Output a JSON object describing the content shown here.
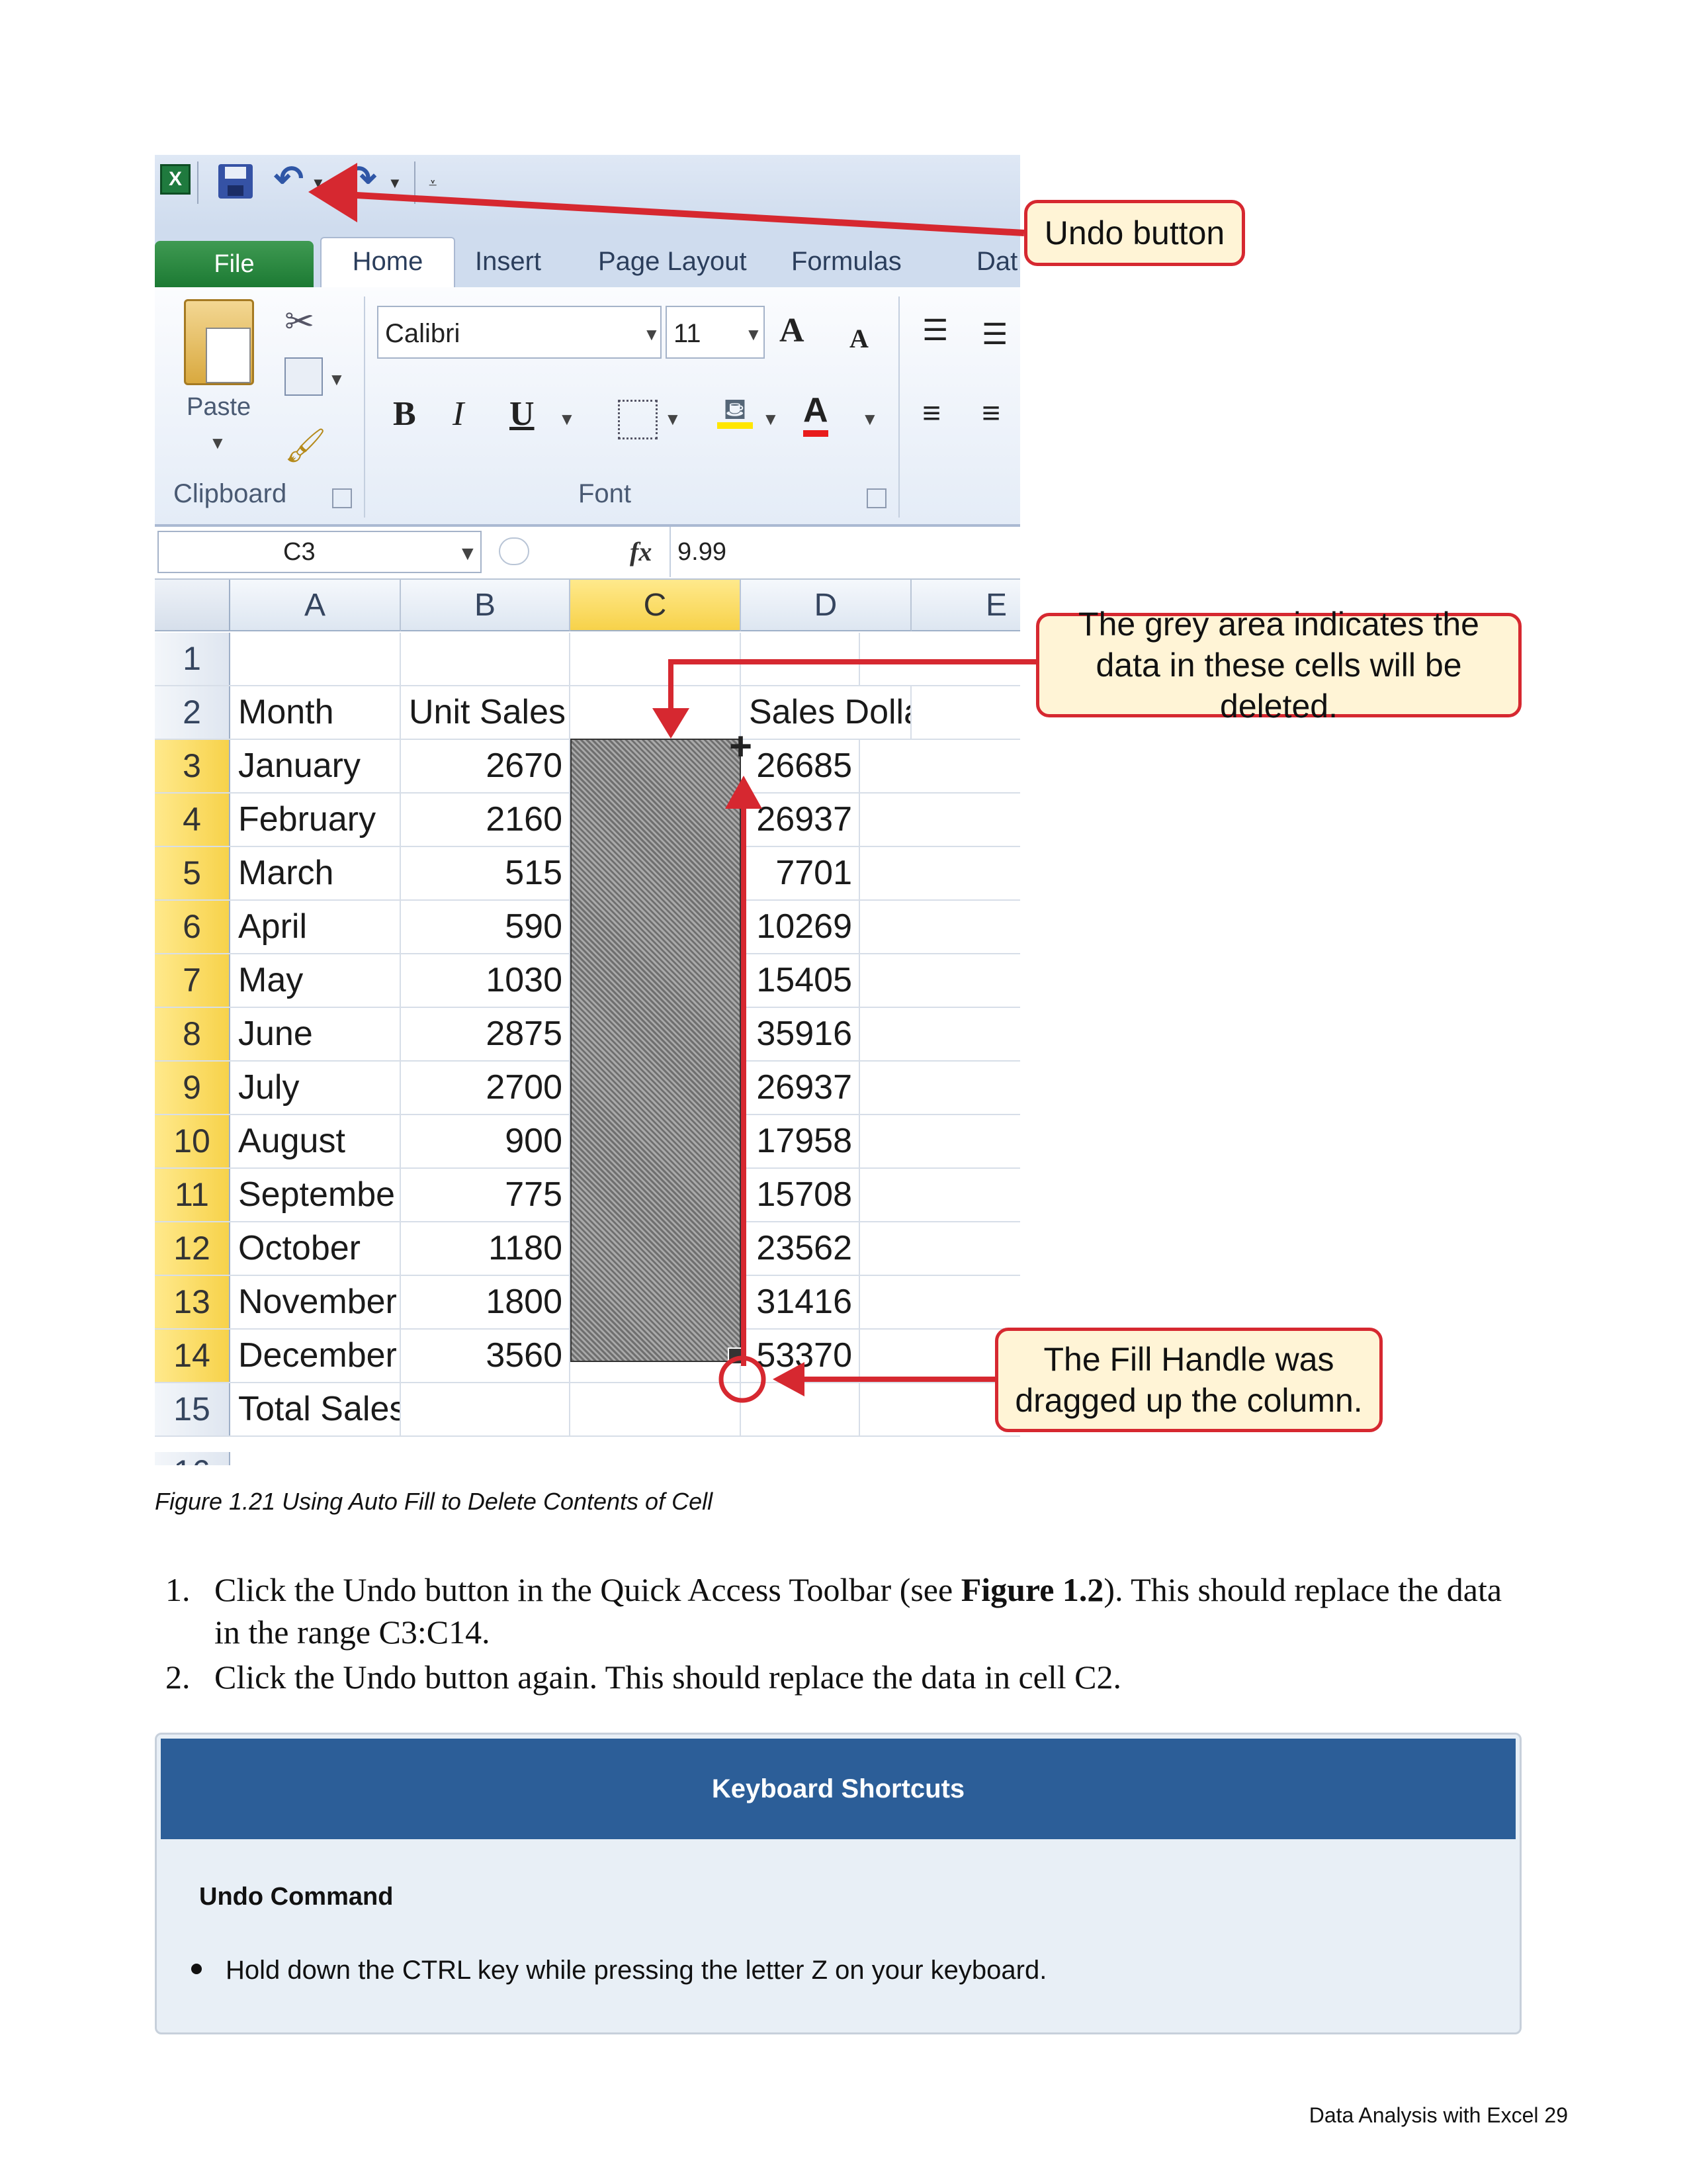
{
  "figure": {
    "title_tabs": {
      "file": "File",
      "home": "Home",
      "insert": "Insert",
      "page_layout": "Page Layout",
      "formulas": "Formulas",
      "data_partial": "Dat"
    },
    "ribbon": {
      "paste_label": "Paste",
      "clipboard_label": "Clipboard",
      "font_group_label": "Font",
      "font_name": "Calibri",
      "font_size": "11",
      "bold": "B",
      "italic": "I",
      "underline": "U",
      "grow_font": "A",
      "shrink_font": "A",
      "font_color": "A"
    },
    "formula_bar": {
      "name_box": "C3",
      "fx_label": "fx",
      "value": "9.99"
    },
    "columns": [
      "A",
      "B",
      "C",
      "D",
      "E"
    ],
    "rows": [
      {
        "num": "1",
        "a": "",
        "b": "",
        "d": ""
      },
      {
        "num": "2",
        "a": "Month",
        "b": "Unit Sales",
        "d": "Sales Dollars"
      },
      {
        "num": "3",
        "a": "January",
        "b": "2670",
        "d": "26685"
      },
      {
        "num": "4",
        "a": "February",
        "b": "2160",
        "d": "26937"
      },
      {
        "num": "5",
        "a": "March",
        "b": "515",
        "d": "7701"
      },
      {
        "num": "6",
        "a": "April",
        "b": "590",
        "d": "10269"
      },
      {
        "num": "7",
        "a": "May",
        "b": "1030",
        "d": "15405"
      },
      {
        "num": "8",
        "a": "June",
        "b": "2875",
        "d": "35916"
      },
      {
        "num": "9",
        "a": "July",
        "b": "2700",
        "d": "26937"
      },
      {
        "num": "10",
        "a": "August",
        "b": "900",
        "d": "17958"
      },
      {
        "num": "11",
        "a": "Septembe",
        "b": "775",
        "d": "15708"
      },
      {
        "num": "12",
        "a": "October",
        "b": "1180",
        "d": "23562"
      },
      {
        "num": "13",
        "a": "November",
        "b": "1800",
        "d": "31416"
      },
      {
        "num": "14",
        "a": "December",
        "b": "3560",
        "d": "53370"
      },
      {
        "num": "15",
        "a": "Total Sales",
        "b": "",
        "d": ""
      }
    ],
    "callouts": {
      "undo": "Undo button",
      "grey_area": "The grey area indicates the data in these cells will be deleted.",
      "fill_handle": "The Fill Handle was dragged up the column."
    },
    "colors": {
      "callout_border": "#d62830",
      "callout_fill": "#fff4d6",
      "selected_header": "#f7d24a"
    }
  },
  "caption": "Figure 1.21  Using Auto Fill to Delete Contents of Cell",
  "steps": [
    {
      "num": "1.",
      "pre": "Click the Undo button in the Quick Access Toolbar (see ",
      "ref": "Figure 1.2",
      "post": "). This should replace the data in the range C3:C14."
    },
    {
      "num": "2.",
      "pre": "Click the Undo button again. This should replace the data in cell C2.",
      "ref": "",
      "post": ""
    }
  ],
  "shortcut_box": {
    "heading": "Keyboard Shortcuts",
    "subheading": "Undo Command",
    "item": "Hold down the CTRL key while pressing the letter Z on your keyboard."
  },
  "footer": "Data Analysis with Excel 29"
}
